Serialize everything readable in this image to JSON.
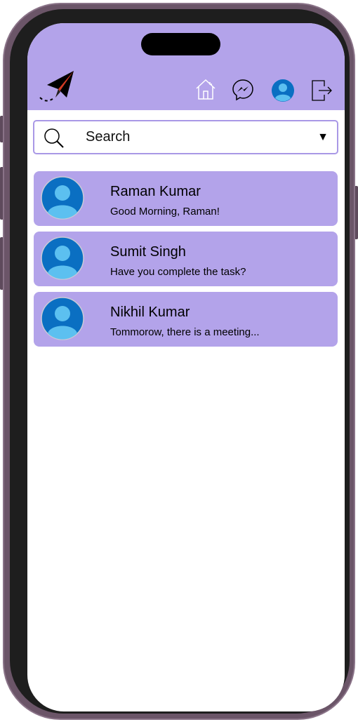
{
  "header": {
    "icons": [
      "paper-plane-logo",
      "home-icon",
      "messenger-icon",
      "profile-icon",
      "logout-icon"
    ]
  },
  "search": {
    "placeholder": "Search",
    "icon": "search-icon",
    "dropdown_icon": "caret-down-icon",
    "caret": "▼"
  },
  "chats": [
    {
      "name": "Raman Kumar",
      "message": "Good Morning, Raman!"
    },
    {
      "name": "Sumit Singh",
      "message": "Have you complete the task?"
    },
    {
      "name": "Nikhil Kumar",
      "message": "Tommorow, there is a meeting..."
    }
  ],
  "colors": {
    "accent": "#b3a3ea",
    "avatar": "#0a6fc2"
  }
}
